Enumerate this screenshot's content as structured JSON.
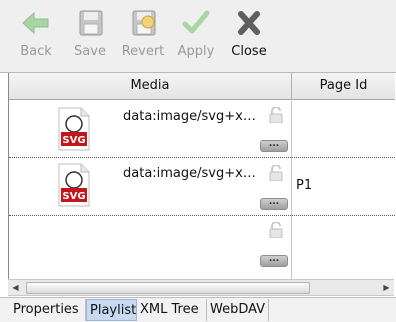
{
  "toolbar": {
    "buttons": [
      {
        "label": "Back",
        "icon": "back-arrow-icon",
        "enabled": false
      },
      {
        "label": "Save",
        "icon": "floppy-disk-icon",
        "enabled": false
      },
      {
        "label": "Revert",
        "icon": "revert-icon",
        "enabled": false
      },
      {
        "label": "Apply",
        "icon": "checkmark-icon",
        "enabled": false
      },
      {
        "label": "Close",
        "icon": "close-x-icon",
        "enabled": true
      }
    ]
  },
  "grid": {
    "columns": [
      "Media",
      "Page Id"
    ],
    "rows": [
      {
        "media": "data:image/svg+x…",
        "page_id": "",
        "thumb_text": "SVG"
      },
      {
        "media": "data:image/svg+x…",
        "page_id": "P1",
        "thumb_text": "SVG"
      },
      {
        "media": "",
        "page_id": "",
        "thumb_text": ""
      }
    ],
    "more_label": "..."
  },
  "scrollbar": {
    "left_arrow": "◀",
    "right_arrow": "▶"
  },
  "tabs": [
    {
      "label": "Properties",
      "active": false
    },
    {
      "label": "Playlist",
      "active": true
    },
    {
      "label": "XML Tree",
      "active": false
    },
    {
      "label": "WebDAV",
      "active": false
    }
  ],
  "colors": {
    "accent_tab": "#c9daf0",
    "svg_badge": "#c4171d"
  }
}
